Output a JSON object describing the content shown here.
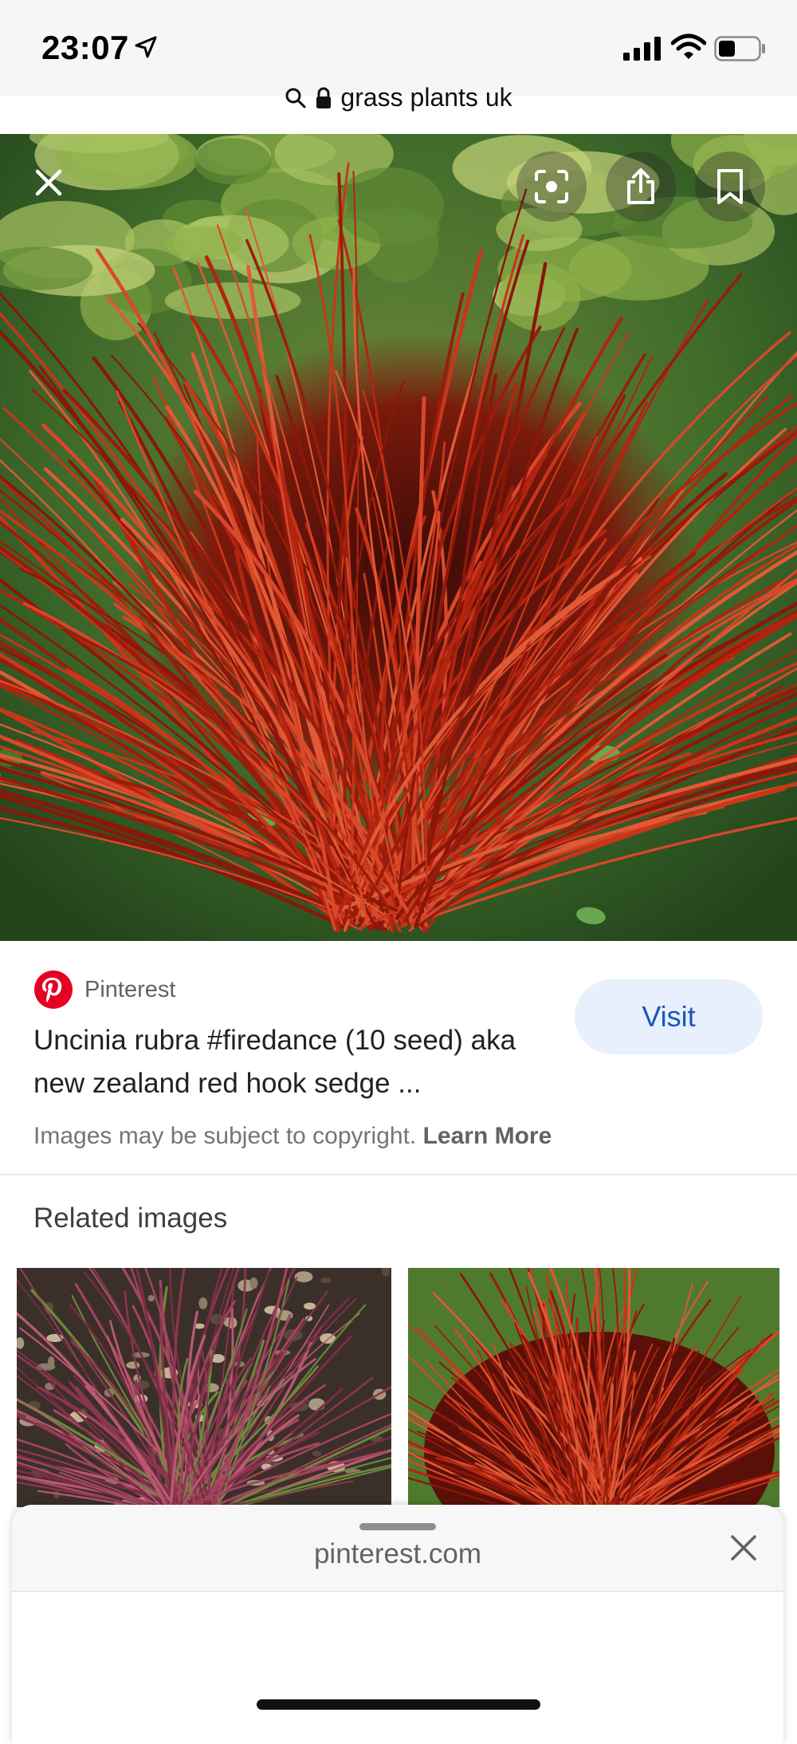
{
  "status": {
    "time": "23:07",
    "location_icon": "location-arrow-icon",
    "signal_icon": "cellular-signal-icon",
    "wifi_icon": "wifi-icon",
    "battery_icon": "battery-icon"
  },
  "browser": {
    "url_text": "grass plants uk",
    "search_icon": "search-icon",
    "lock_icon": "lock-icon"
  },
  "viewer": {
    "close_icon": "close-icon",
    "lens_icon": "lens-icon",
    "share_icon": "share-icon",
    "save_icon": "bookmark-icon"
  },
  "result": {
    "source_name": "Pinterest",
    "visit_label": "Visit",
    "title": "Uncinia rubra #firedance (10 seed) aka new zealand red hook sedge ...",
    "copyright_text": "Images may be subject to copyright.",
    "learn_more": "Learn More"
  },
  "related": {
    "title": "Related images"
  },
  "sheet": {
    "domain": "pinterest.com"
  },
  "colors": {
    "visit_bg": "#e8f0fe",
    "visit_text": "#1a57b7",
    "pinterest_red": "#e60023"
  }
}
